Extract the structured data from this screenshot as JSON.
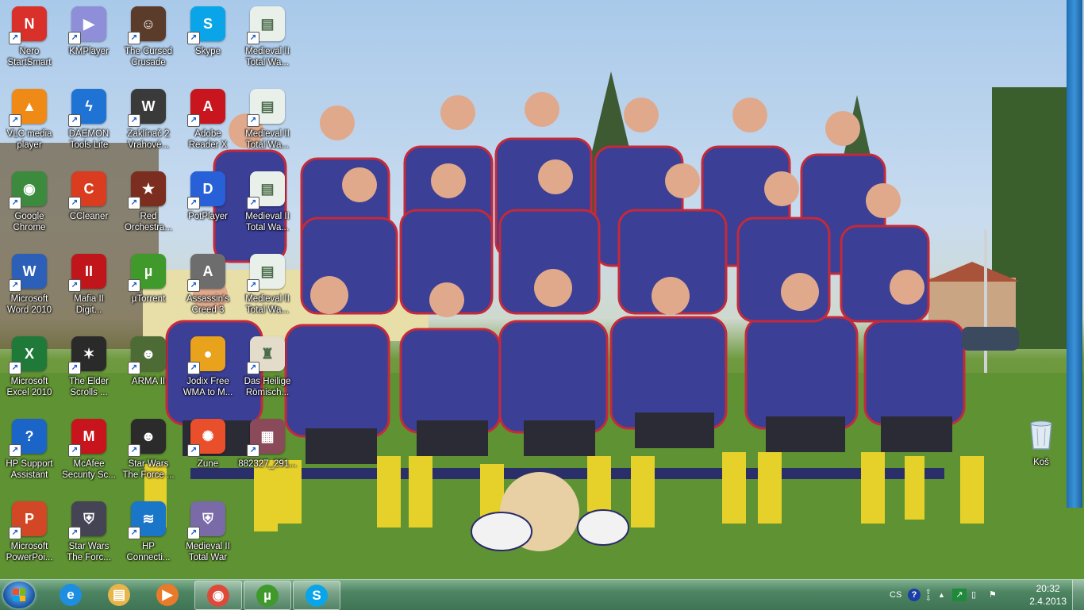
{
  "desktop": {
    "icons": [
      {
        "label": "Nero\nStartSmart",
        "icon": "nero-icon",
        "color": "#d9302a",
        "glyph": "N"
      },
      {
        "label": "KMPlayer",
        "icon": "kmplayer-icon",
        "color": "#8e8fd8",
        "glyph": "▶"
      },
      {
        "label": "The Cursed\nCrusade",
        "icon": "game-portrait-icon",
        "color": "#5b3b2a",
        "glyph": "☺"
      },
      {
        "label": "Skype",
        "icon": "skype-icon",
        "color": "#0aa4e8",
        "glyph": "S"
      },
      {
        "label": "Medieval II\nTotal Wa...",
        "icon": "document-shortcut-icon",
        "color": "#e9efe9",
        "glyph": "▤"
      },
      {
        "label": "VLC media\nplayer",
        "icon": "vlc-cone-icon",
        "color": "#f08a16",
        "glyph": "▲"
      },
      {
        "label": "DAEMON\nTools Lite",
        "icon": "daemon-tools-icon",
        "color": "#1e73d4",
        "glyph": "ϟ"
      },
      {
        "label": "Zaklínač 2\nVrahové...",
        "icon": "witcher-icon",
        "color": "#3a3a3a",
        "glyph": "W"
      },
      {
        "label": "Adobe\nReader X",
        "icon": "adobe-reader-icon",
        "color": "#c9151e",
        "glyph": "A"
      },
      {
        "label": "Medieval II\nTotal Wa...",
        "icon": "document-shortcut-icon",
        "color": "#e9efe9",
        "glyph": "▤"
      },
      {
        "label": "Google\nChrome",
        "icon": "chrome-icon",
        "color": "#3b8a3e",
        "glyph": "◉"
      },
      {
        "label": "CCleaner",
        "icon": "ccleaner-icon",
        "color": "#d93c1f",
        "glyph": "C"
      },
      {
        "label": "Red\nOrchestra...",
        "icon": "red-star-icon",
        "color": "#7b2e20",
        "glyph": "★"
      },
      {
        "label": "PotPlayer",
        "icon": "potplayer-icon",
        "color": "#2860d8",
        "glyph": "D"
      },
      {
        "label": "Medieval II\nTotal Wa...",
        "icon": "document-shortcut-icon",
        "color": "#e9efe9",
        "glyph": "▤"
      },
      {
        "label": "Microsoft\nWord 2010",
        "icon": "word-icon",
        "color": "#2b5fb8",
        "glyph": "W"
      },
      {
        "label": "Mafia II\nDigit...",
        "icon": "mafia-icon",
        "color": "#c0161b",
        "glyph": "II"
      },
      {
        "label": "µTorrent",
        "icon": "utorrent-icon",
        "color": "#3f9a2b",
        "glyph": "µ"
      },
      {
        "label": "Assassin's\nCreed 3",
        "icon": "assassins-creed-icon",
        "color": "#6d6d6d",
        "glyph": "A"
      },
      {
        "label": "Medieval II\nTotal Wa...",
        "icon": "document-shortcut-icon",
        "color": "#e9efe9",
        "glyph": "▤"
      },
      {
        "label": "Microsoft\nExcel 2010",
        "icon": "excel-icon",
        "color": "#1f7a3a",
        "glyph": "X"
      },
      {
        "label": "The Elder\nScrolls ...",
        "icon": "skyrim-icon",
        "color": "#2a2a2a",
        "glyph": "✶"
      },
      {
        "label": "ARMA II",
        "icon": "arma-icon",
        "color": "#4d6b35",
        "glyph": "☻"
      },
      {
        "label": "Jodix Free\nWMA to M...",
        "icon": "jodix-icon",
        "color": "#e8a21b",
        "glyph": "●"
      },
      {
        "label": "Das Heilige\nRömisch...",
        "icon": "document-shortcut-icon",
        "color": "#e4dccb",
        "glyph": "♜"
      },
      {
        "label": "HP Support\nAssistant",
        "icon": "help-icon",
        "color": "#1b64c8",
        "glyph": "?"
      },
      {
        "label": "McAfee\nSecurity Sc...",
        "icon": "mcafee-icon",
        "color": "#c8141c",
        "glyph": "M"
      },
      {
        "label": "Star Wars\nThe Force ...",
        "icon": "star-wars-icon",
        "color": "#2b2b2b",
        "glyph": "☻"
      },
      {
        "label": "Zune",
        "icon": "zune-icon",
        "color": "#e94f2a",
        "glyph": "✺"
      },
      {
        "label": "882327_291...",
        "icon": "image-file-icon",
        "color": "#8a4a5a",
        "glyph": "▦"
      },
      {
        "label": "Microsoft\nPowerPoi...",
        "icon": "powerpoint-icon",
        "color": "#d24726",
        "glyph": "P"
      },
      {
        "label": "Star Wars\nThe Forc...",
        "icon": "star-wars-shield-icon",
        "color": "#445",
        "glyph": "⛨"
      },
      {
        "label": "HP\nConnecti...",
        "icon": "hp-connect-icon",
        "color": "#1a76c9",
        "glyph": "≋"
      },
      {
        "label": "Medieval II\nTotal War",
        "icon": "medieval-shield-icon",
        "color": "#7a6aa8",
        "glyph": "⛨"
      }
    ],
    "recycle_bin": {
      "label": "Koš",
      "icon": "recycle-bin-icon"
    }
  },
  "taskbar": {
    "start": {
      "icon": "windows-start-icon"
    },
    "pinned": [
      {
        "name": "internet-explorer",
        "icon": "internet-explorer-icon",
        "glyph": "e",
        "color": "#1e8fe0",
        "open": false
      },
      {
        "name": "windows-explorer",
        "icon": "folder-icon",
        "glyph": "▤",
        "color": "#e8b54a",
        "open": false
      },
      {
        "name": "media-player",
        "icon": "media-player-icon",
        "glyph": "▶",
        "color": "#e87a2a",
        "open": false
      },
      {
        "name": "chrome",
        "icon": "chrome-icon",
        "glyph": "◉",
        "color": "#dd4a3a",
        "open": true
      },
      {
        "name": "utorrent",
        "icon": "utorrent-icon",
        "glyph": "µ",
        "color": "#3f9a2b",
        "open": true
      },
      {
        "name": "skype",
        "icon": "skype-icon",
        "glyph": "S",
        "color": "#0aa4e8",
        "open": true
      }
    ],
    "tray": {
      "language": "CS",
      "time": "20:32",
      "date": "2.4.2013"
    }
  }
}
